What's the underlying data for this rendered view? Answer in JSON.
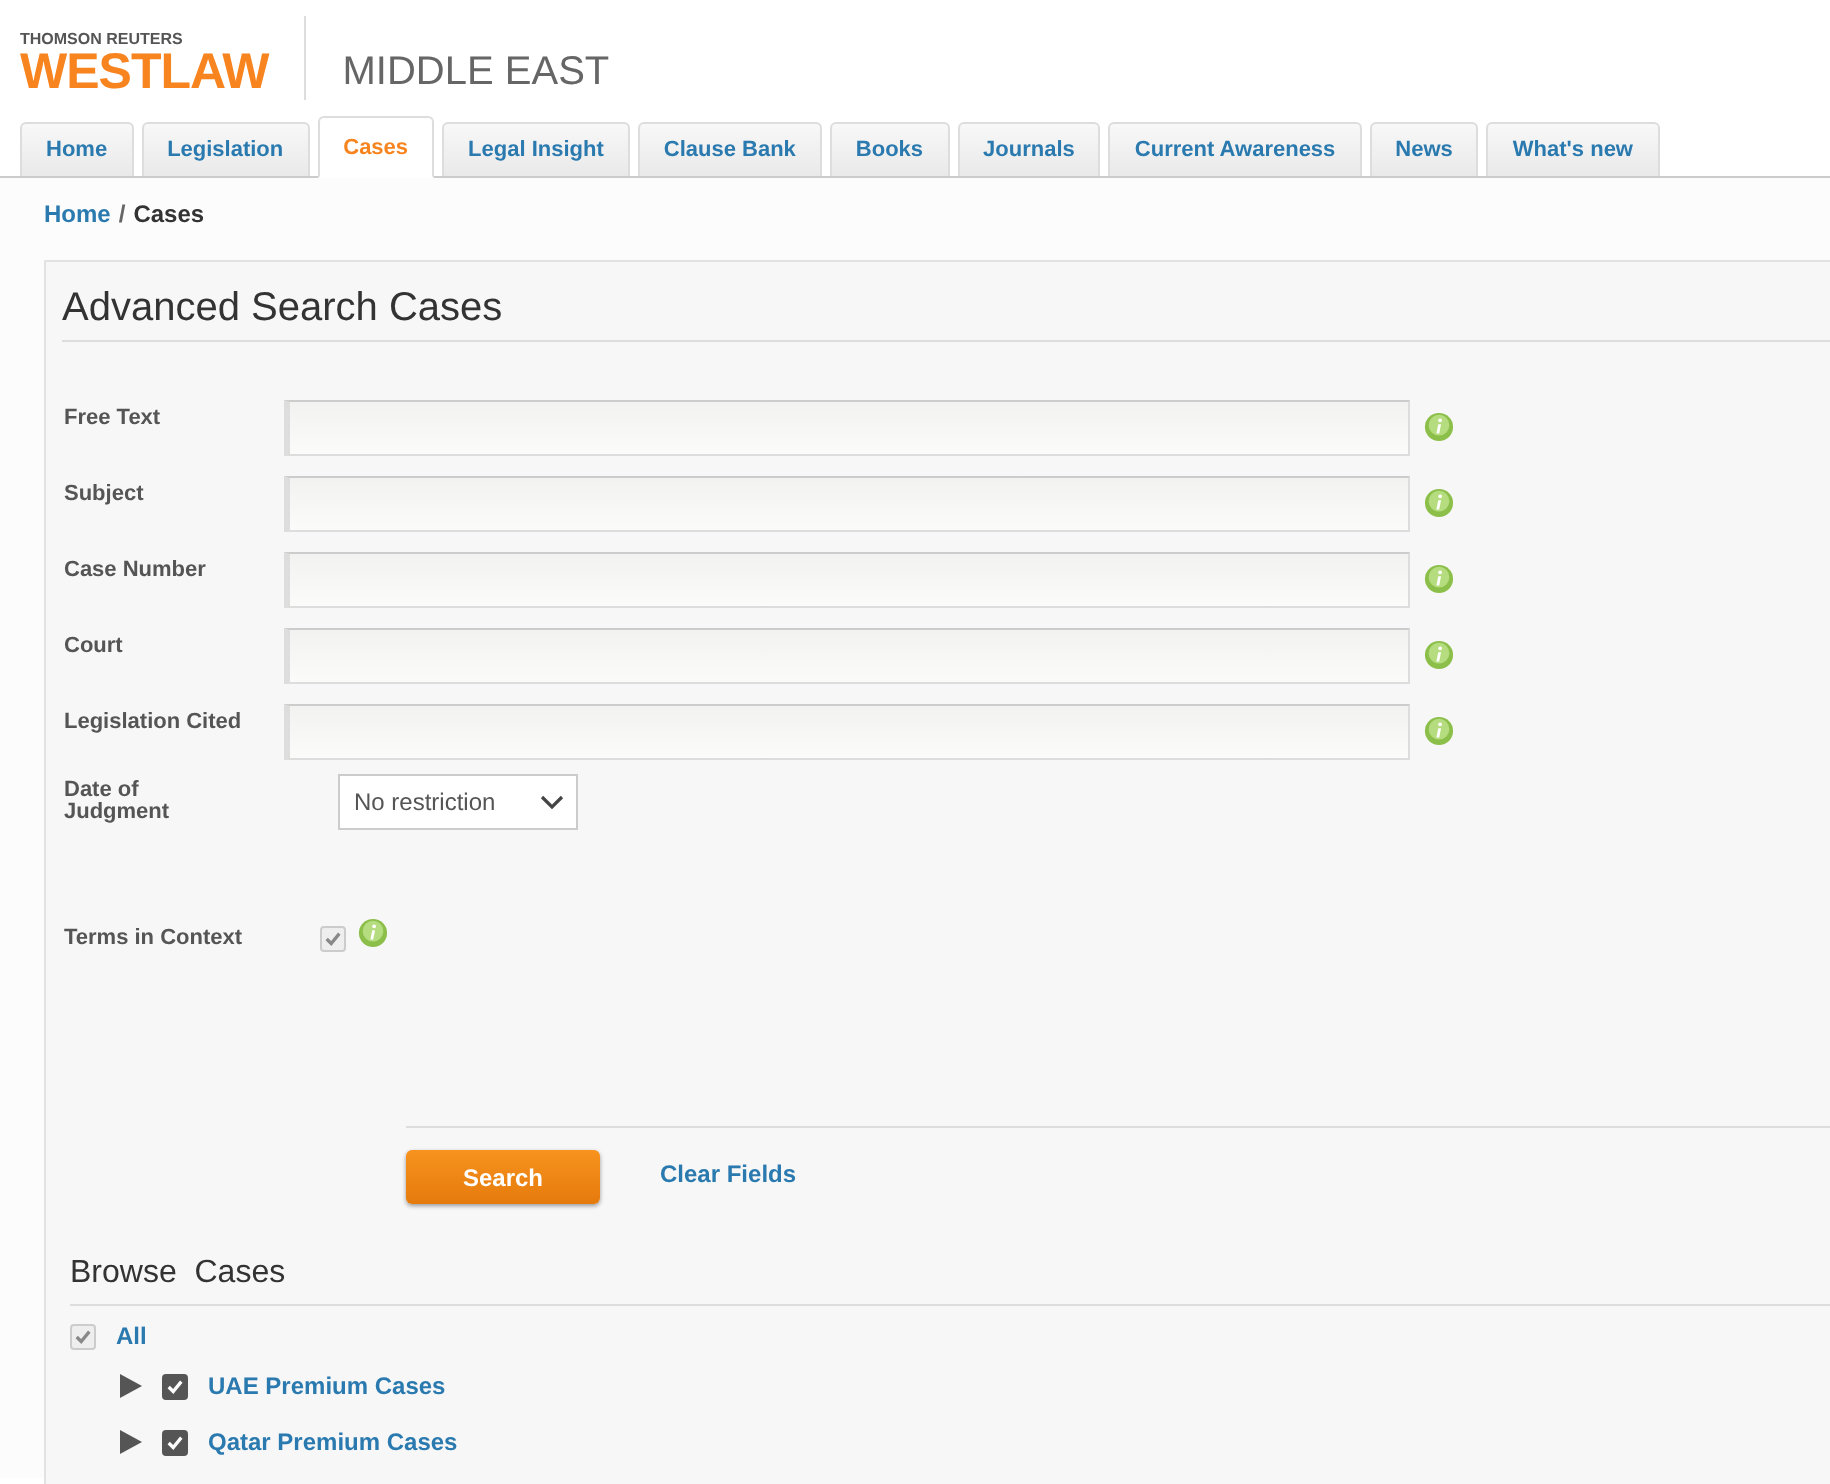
{
  "header": {
    "brand_top": "THOMSON REUTERS",
    "brand": "WESTLAW",
    "region": "MIDDLE EAST"
  },
  "tabs": [
    {
      "label": "Home",
      "selected": false
    },
    {
      "label": "Legislation",
      "selected": false
    },
    {
      "label": "Cases",
      "selected": true
    },
    {
      "label": "Legal Insight",
      "selected": false
    },
    {
      "label": "Clause Bank",
      "selected": false
    },
    {
      "label": "Books",
      "selected": false
    },
    {
      "label": "Journals",
      "selected": false
    },
    {
      "label": "Current Awareness",
      "selected": false
    },
    {
      "label": "News",
      "selected": false
    },
    {
      "label": "What's new",
      "selected": false
    }
  ],
  "breadcrumb": {
    "link": "Home",
    "separator": "/",
    "current": "Cases"
  },
  "title": "Advanced Search Cases",
  "fields": [
    {
      "label": "Free Text"
    },
    {
      "label": "Subject"
    },
    {
      "label": "Case Number"
    },
    {
      "label": "Court"
    },
    {
      "label": "Legislation Cited"
    }
  ],
  "date": {
    "label": "Date of Judgment",
    "value": "No restriction"
  },
  "terms": {
    "label": "Terms in Context",
    "checked": true,
    "disabled": true
  },
  "buttons": {
    "search": "Search",
    "clear": "Clear Fields"
  },
  "browse": {
    "title": "Browse  Cases",
    "all": {
      "label": "All",
      "checked": true,
      "disabled": true
    },
    "items": [
      {
        "label": "UAE Premium Cases",
        "checked": true,
        "expanded": false
      },
      {
        "label": "Qatar Premium Cases",
        "checked": true,
        "expanded": false
      }
    ]
  }
}
